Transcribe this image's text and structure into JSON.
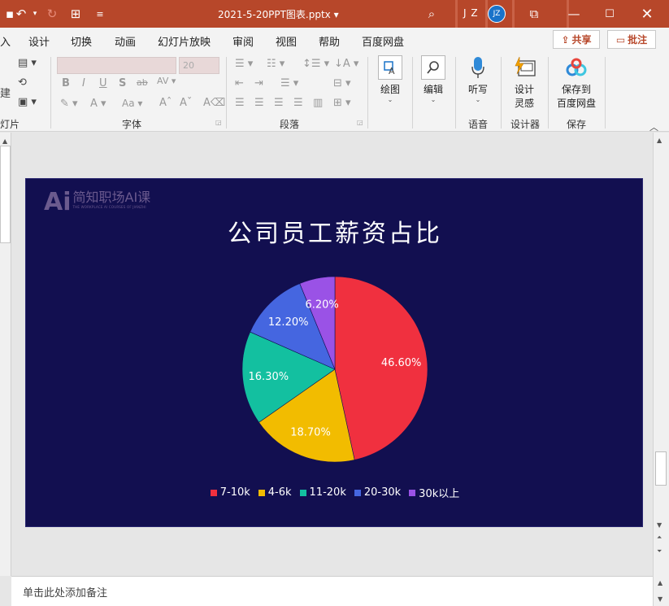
{
  "titlebar": {
    "document_title": "2021-5-20PPT图表.pptx ▾",
    "user_initials": "J Z",
    "avatar_initials": "JZ",
    "bg_color": "#b7472a"
  },
  "menu": {
    "tabs": [
      "入",
      "设计",
      "切换",
      "动画",
      "幻灯片放映",
      "审阅",
      "视图",
      "帮助",
      "百度网盘"
    ],
    "share_label": "共享",
    "comment_label": "批注"
  },
  "ribbon": {
    "group_labels": {
      "slides": "灯片",
      "font": "字体",
      "paragraph": "段落",
      "voice": "语音",
      "designer": "设计器",
      "save": "保存"
    },
    "font_size_placeholder": "20",
    "slides_btn_label": "建",
    "draw_label": "绘图",
    "edit_label": "编辑",
    "dictate_label": "听写",
    "design_ideas_label_1": "设计",
    "design_ideas_label_2": "灵感",
    "save_baidu_label_1": "保存到",
    "save_baidu_label_2": "百度网盘"
  },
  "slide": {
    "logo_mark": "Ai",
    "logo_cn": "简知职场AI课",
    "logo_en": "THE WORKPLACE AI COURSES OF JIANZHI",
    "bg_color": "#120f50"
  },
  "chart_data": {
    "type": "pie",
    "title": "公司员工薪资占比",
    "categories": [
      "7-10k",
      "4-6k",
      "11-20k",
      "20-30k",
      "30k以上"
    ],
    "values": [
      46.6,
      18.7,
      16.3,
      12.2,
      6.2
    ],
    "labels": [
      "46.60%",
      "18.70%",
      "16.30%",
      "12.20%",
      "6.20%"
    ],
    "colors": [
      "#f0303f",
      "#f2bc00",
      "#13c0a0",
      "#4566e0",
      "#9a52e6"
    ],
    "start_angle": "12 o'clock, clockwise",
    "legend_position": "bottom"
  },
  "notes": {
    "placeholder": "单击此处添加备注"
  }
}
